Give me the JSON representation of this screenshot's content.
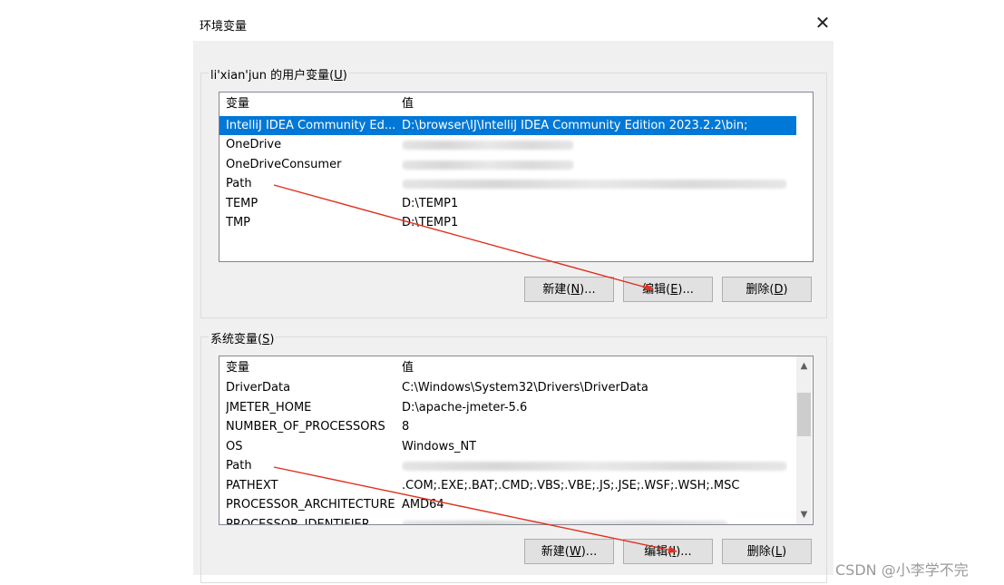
{
  "dialog": {
    "title": "环境变量"
  },
  "user_vars": {
    "label_prefix": "li'xian'jun 的用户变量(",
    "label_key": "U",
    "label_suffix": ")",
    "columns": [
      "变量",
      "值"
    ],
    "rows": [
      {
        "name": "IntelliJ IDEA Community Ed...",
        "value": "D:\\browser\\IJ\\IntelliJ IDEA Community Edition 2023.2.2\\bin;",
        "selected": true
      },
      {
        "name": "OneDrive",
        "value": ""
      },
      {
        "name": "OneDriveConsumer",
        "value": ""
      },
      {
        "name": "Path",
        "value": ""
      },
      {
        "name": "TEMP",
        "value": "D:\\TEMP1"
      },
      {
        "name": "TMP",
        "value": "D:\\TEMP1"
      }
    ],
    "buttons": {
      "new_prefix": "新建(",
      "new_key": "N",
      "new_suffix": ")...",
      "edit_prefix": "编辑(",
      "edit_key": "E",
      "edit_suffix": ")...",
      "delete_prefix": "删除(",
      "delete_key": "D",
      "delete_suffix": ")"
    }
  },
  "system_vars": {
    "label_prefix": "系统变量(",
    "label_key": "S",
    "label_suffix": ")",
    "columns": [
      "变量",
      "值"
    ],
    "rows": [
      {
        "name": "DriverData",
        "value": "C:\\Windows\\System32\\Drivers\\DriverData"
      },
      {
        "name": "JMETER_HOME",
        "value": "D:\\apache-jmeter-5.6"
      },
      {
        "name": "NUMBER_OF_PROCESSORS",
        "value": "8"
      },
      {
        "name": "OS",
        "value": "Windows_NT"
      },
      {
        "name": "Path",
        "value": ""
      },
      {
        "name": "PATHEXT",
        "value": ".COM;.EXE;.BAT;.CMD;.VBS;.VBE;.JS;.JSE;.WSF;.WSH;.MSC"
      },
      {
        "name": "PROCESSOR_ARCHITECTURE",
        "value": "AMD64"
      },
      {
        "name": "PROCESSOR_IDENTIFIER",
        "value": ""
      }
    ],
    "buttons": {
      "new_prefix": "新建(",
      "new_key": "W",
      "new_suffix": ")...",
      "edit_prefix": "编辑(",
      "edit_key": "I",
      "edit_suffix": ")...",
      "delete_prefix": "删除(",
      "delete_key": "L",
      "delete_suffix": ")"
    }
  },
  "watermark": "CSDN @小李学不完",
  "colors": {
    "selection": "#0078d7",
    "arrow": "#e0301e"
  }
}
